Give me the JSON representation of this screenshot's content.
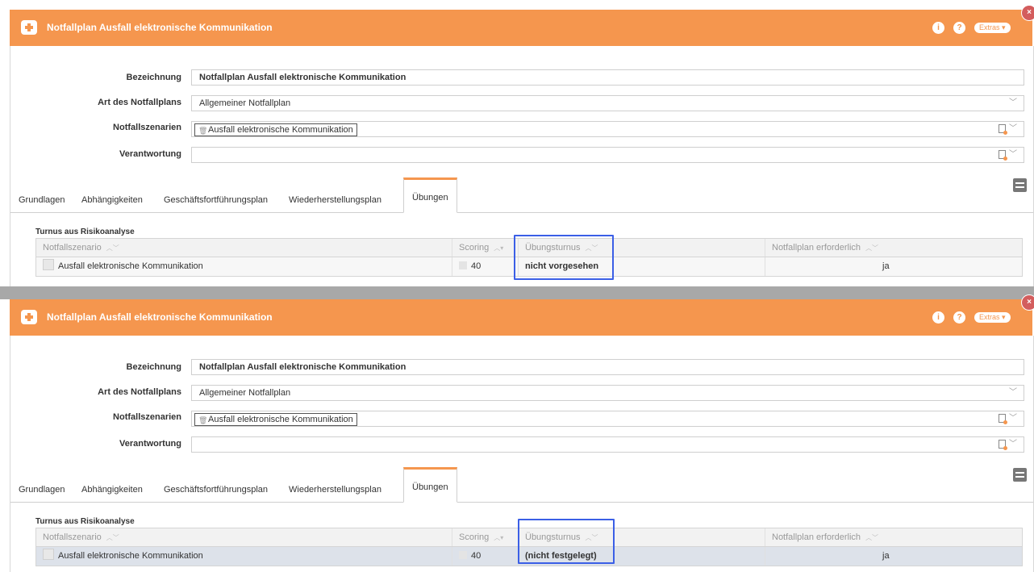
{
  "panels": [
    {
      "title": "Notfallplan Ausfall elektronische Kommunikation",
      "header_buttons": {
        "info": "i",
        "help": "?",
        "extras": "Extras ▾",
        "close": "×"
      },
      "fields": {
        "bezeichnung_label": "Bezeichnung",
        "bezeichnung_value": "Notfallplan Ausfall elektronische Kommunikation",
        "art_label": "Art des Notfallplans",
        "art_value": "Allgemeiner Notfallplan",
        "szenarien_label": "Notfallszenarien",
        "szenarien_chip": "Ausfall elektronische Kommunikation",
        "verantwortung_label": "Verantwortung",
        "verantwortung_value": ""
      },
      "tabs": [
        "Grundlagen",
        "Abhängigkeiten",
        "Geschäftsfortführungsplan",
        "Wiederherstellungsplan",
        "Übungen"
      ],
      "active_tab": "Übungen",
      "section_title": "Turnus aus Risikoanalyse",
      "grid": {
        "headers": [
          "Notfallszenario",
          "Scoring",
          "Übungsturnus",
          "Notfallplan erforderlich"
        ],
        "row": {
          "szenario": "Ausfall elektronische Kommunikation",
          "scoring": "40",
          "turnus": "nicht vorgesehen",
          "erforderlich": "ja"
        }
      }
    },
    {
      "title": "Notfallplan Ausfall elektronische Kommunikation",
      "header_buttons": {
        "info": "i",
        "help": "?",
        "extras": "Extras ▾",
        "close": "×"
      },
      "fields": {
        "bezeichnung_label": "Bezeichnung",
        "bezeichnung_value": "Notfallplan Ausfall elektronische Kommunikation",
        "art_label": "Art des Notfallplans",
        "art_value": "Allgemeiner Notfallplan",
        "szenarien_label": "Notfallszenarien",
        "szenarien_chip": "Ausfall elektronische Kommunikation",
        "verantwortung_label": "Verantwortung",
        "verantwortung_value": ""
      },
      "tabs": [
        "Grundlagen",
        "Abhängigkeiten",
        "Geschäftsfortführungsplan",
        "Wiederherstellungsplan",
        "Übungen"
      ],
      "active_tab": "Übungen",
      "section_title": "Turnus aus Risikoanalyse",
      "grid": {
        "headers": [
          "Notfallszenario",
          "Scoring",
          "Übungsturnus",
          "Notfallplan erforderlich"
        ],
        "row": {
          "szenario": "Ausfall elektronische Kommunikation",
          "scoring": "40",
          "turnus": "(nicht festgelegt)",
          "erforderlich": "ja"
        }
      }
    }
  ],
  "colors": {
    "accent": "#f5964e",
    "highlight": "#3b5fe6"
  }
}
